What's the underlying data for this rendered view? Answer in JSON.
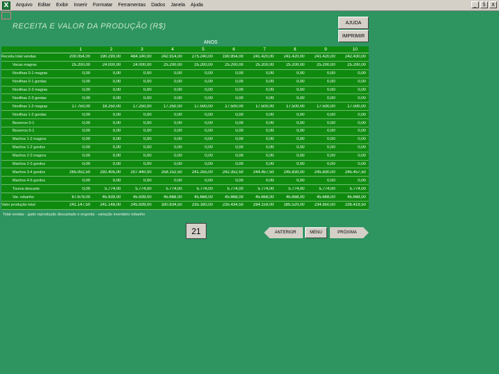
{
  "menubar": {
    "items": [
      "Arquivo",
      "Editar",
      "Exibir",
      "Inserir",
      "Formatar",
      "Ferramentas",
      "Dados",
      "Janela",
      "Ajuda"
    ],
    "controls": [
      "_",
      "Š",
      "X"
    ]
  },
  "page": {
    "title": "RECEITA E VALOR DA PRODUÇÃO (R$)",
    "ajuda_label": "AJUDA",
    "imprimir_label": "IMPRIMIR",
    "anos_label": "ANOS",
    "footnote": "Total vendas - gado reprodução descartado e engorda - variação inventário rebanho",
    "page_number": "21",
    "nav_prev": "ANTERIOR",
    "nav_menu": "MENU",
    "nav_next": "PRÓXIMA"
  },
  "table": {
    "years": [
      "1",
      "2",
      "3",
      "4",
      "5",
      "6",
      "7",
      "8",
      "9",
      "10"
    ],
    "rows": [
      {
        "label": "Receita total vendas",
        "indent": false,
        "values": [
          "200.054,00",
          "190.290,00",
          "484.140,00",
          "242.914,00",
          "275.240,00",
          "190.954,00",
          "241.420,00",
          "241.420,00",
          "241.420,00",
          "242.430,00"
        ]
      },
      {
        "label": "Vacas magras",
        "indent": true,
        "values": [
          "25.200,00",
          "24.000,00",
          "24.000,00",
          "25.200,00",
          "25.200,00",
          "25.200,00",
          "25.200,00",
          "25.200,00",
          "25.200,00",
          "25.200,00"
        ]
      },
      {
        "label": "Novilhas 0-1 magras",
        "indent": true,
        "values": [
          "0,00",
          "0,00",
          "0,00",
          "0,00",
          "0,00",
          "0,00",
          "0,00",
          "0,00",
          "0,00",
          "0,00"
        ]
      },
      {
        "label": "Novilhas 0-1 gordas",
        "indent": true,
        "values": [
          "0,00",
          "0,00",
          "0,00",
          "0,00",
          "0,00",
          "0,00",
          "0,00",
          "0,00",
          "0,00",
          "0,00"
        ]
      },
      {
        "label": "Novilhas 2-3 magras",
        "indent": true,
        "values": [
          "0,00",
          "0,00",
          "0,00",
          "0,00",
          "0,00",
          "0,00",
          "0,00",
          "0,00",
          "0,00",
          "0,00"
        ]
      },
      {
        "label": "Novilhas 2-3 gordas",
        "indent": true,
        "values": [
          "0,00",
          "0,00",
          "0,00",
          "0,00",
          "0,00",
          "0,00",
          "0,00",
          "0,00",
          "0,00",
          "0,00"
        ]
      },
      {
        "label": "Novilhas 1-2 magras",
        "indent": true,
        "values": [
          "17.750,00",
          "18.250,00",
          "17.250,00",
          "17.250,00",
          "17.500,00",
          "17.500,00",
          "17.500,00",
          "17.500,00",
          "17.500,00",
          "17.500,00"
        ]
      },
      {
        "label": "Novilhas 1-2 gordas",
        "indent": true,
        "values": [
          "0,00",
          "0,00",
          "0,00",
          "0,00",
          "0,00",
          "0,00",
          "0,00",
          "0,00",
          "0,00",
          "0,00"
        ]
      },
      {
        "label": "Bezerros 0-1",
        "indent": true,
        "values": [
          "0,00",
          "0,00",
          "0,00",
          "0,00",
          "0,00",
          "0,00",
          "0,00",
          "0,00",
          "0,00",
          "0,00"
        ]
      },
      {
        "label": "Bezerros 0-1",
        "indent": true,
        "values": [
          "0,00",
          "0,00",
          "0,00",
          "0,00",
          "0,00",
          "0,00",
          "0,00",
          "0,00",
          "0,00",
          "0,00"
        ]
      },
      {
        "label": "Machos 1-2 magros",
        "indent": true,
        "values": [
          "0,00",
          "0,00",
          "0,00",
          "0,00",
          "0,00",
          "0,00",
          "0,00",
          "0,00",
          "0,00",
          "0,00"
        ]
      },
      {
        "label": "Machos 1-2 gordos",
        "indent": true,
        "values": [
          "0,00",
          "0,00",
          "0,00",
          "0,00",
          "0,00",
          "0,00",
          "0,00",
          "0,00",
          "0,00",
          "0,00"
        ]
      },
      {
        "label": "Machos 2-3 magros",
        "indent": true,
        "values": [
          "0,00",
          "0,00",
          "0,00",
          "0,00",
          "0,00",
          "0,00",
          "0,00",
          "0,00",
          "0,00",
          "0,00"
        ]
      },
      {
        "label": "Machos 2-3 gordos",
        "indent": true,
        "values": [
          "0,00",
          "0,00",
          "0,00",
          "0,00",
          "0,00",
          "0,00",
          "0,00",
          "0,00",
          "0,00",
          "0,00"
        ]
      },
      {
        "label": "Machos 3-4 gordos",
        "indent": true,
        "values": [
          "265.052,50",
          "292.405,00",
          "207.440,00",
          "258.152,50",
          "241.255,00",
          "242.352,50",
          "244.457,50",
          "245.830,00",
          "245.830,00",
          "245.457,50"
        ]
      },
      {
        "label": "Machos 4-5 gordos",
        "indent": true,
        "values": [
          "0,00",
          "0,00",
          "0,00",
          "0,00",
          "0,00",
          "0,00",
          "0,00",
          "0,00",
          "0,00",
          "0,00"
        ]
      },
      {
        "label": "Touros descarte",
        "indent": true,
        "values": [
          "0,00",
          "5.774,00",
          "5.774,00",
          "5.774,00",
          "5.774,00",
          "5.774,00",
          "5.774,00",
          "5.774,00",
          "5.774,00",
          "5.774,00"
        ]
      },
      {
        "label": "Var. rebanho",
        "indent": true,
        "values": [
          "67.679,00",
          "45.939,00",
          "45.939,00",
          "45.668,00",
          "45.668,00",
          "45.668,00",
          "45.668,00",
          "45.668,00",
          "45.668,00",
          "45.668,00"
        ]
      },
      {
        "label": "Valor produção total",
        "indent": false,
        "values": [
          "241.147,50",
          "241.148,00",
          "245.939,00",
          "330.834,50",
          "235.160,00",
          "235.434,50",
          "284.159,00",
          "285.520,00",
          "234.850,00",
          "236.419,50"
        ]
      }
    ]
  }
}
